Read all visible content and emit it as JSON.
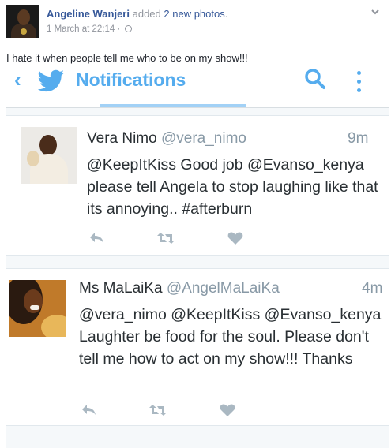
{
  "post": {
    "author": "Angeline Wanjeri",
    "action_prefix": "added",
    "action_link": "2 new photos",
    "action_suffix": ".",
    "timestamp": "1 March at 22:14 ·",
    "privacy_icon": "globe-icon",
    "menu_icon": "chevron-down-icon",
    "status": "I hate it when people tell me who to be on my show!!!"
  },
  "app": {
    "back_icon": "back-arrow-icon",
    "brand_icon": "twitter-bird-icon",
    "title": "Notifications",
    "search_icon": "search-icon",
    "more_icon": "more-vertical-icon",
    "accent": "#55acee"
  },
  "tweets": [
    {
      "name": "Vera Nimo",
      "handle": "@vera_nimo",
      "time": "9m",
      "text": "@KeepItKiss Good job @Evanso_kenya please tell Angela to stop laughing like that its annoying.. #afterburn",
      "actions": [
        "reply-icon",
        "retweet-icon",
        "like-icon"
      ]
    },
    {
      "name": "Ms MaLaiKa",
      "handle": "@AngelMaLaiKa",
      "time": "4m",
      "text": "@vera_nimo @KeepItKiss @Evanso_kenya Laughter be food for the soul. Please don't tell me how to act on my show!!! Thanks",
      "actions": [
        "reply-icon",
        "retweet-icon",
        "like-icon"
      ]
    }
  ]
}
